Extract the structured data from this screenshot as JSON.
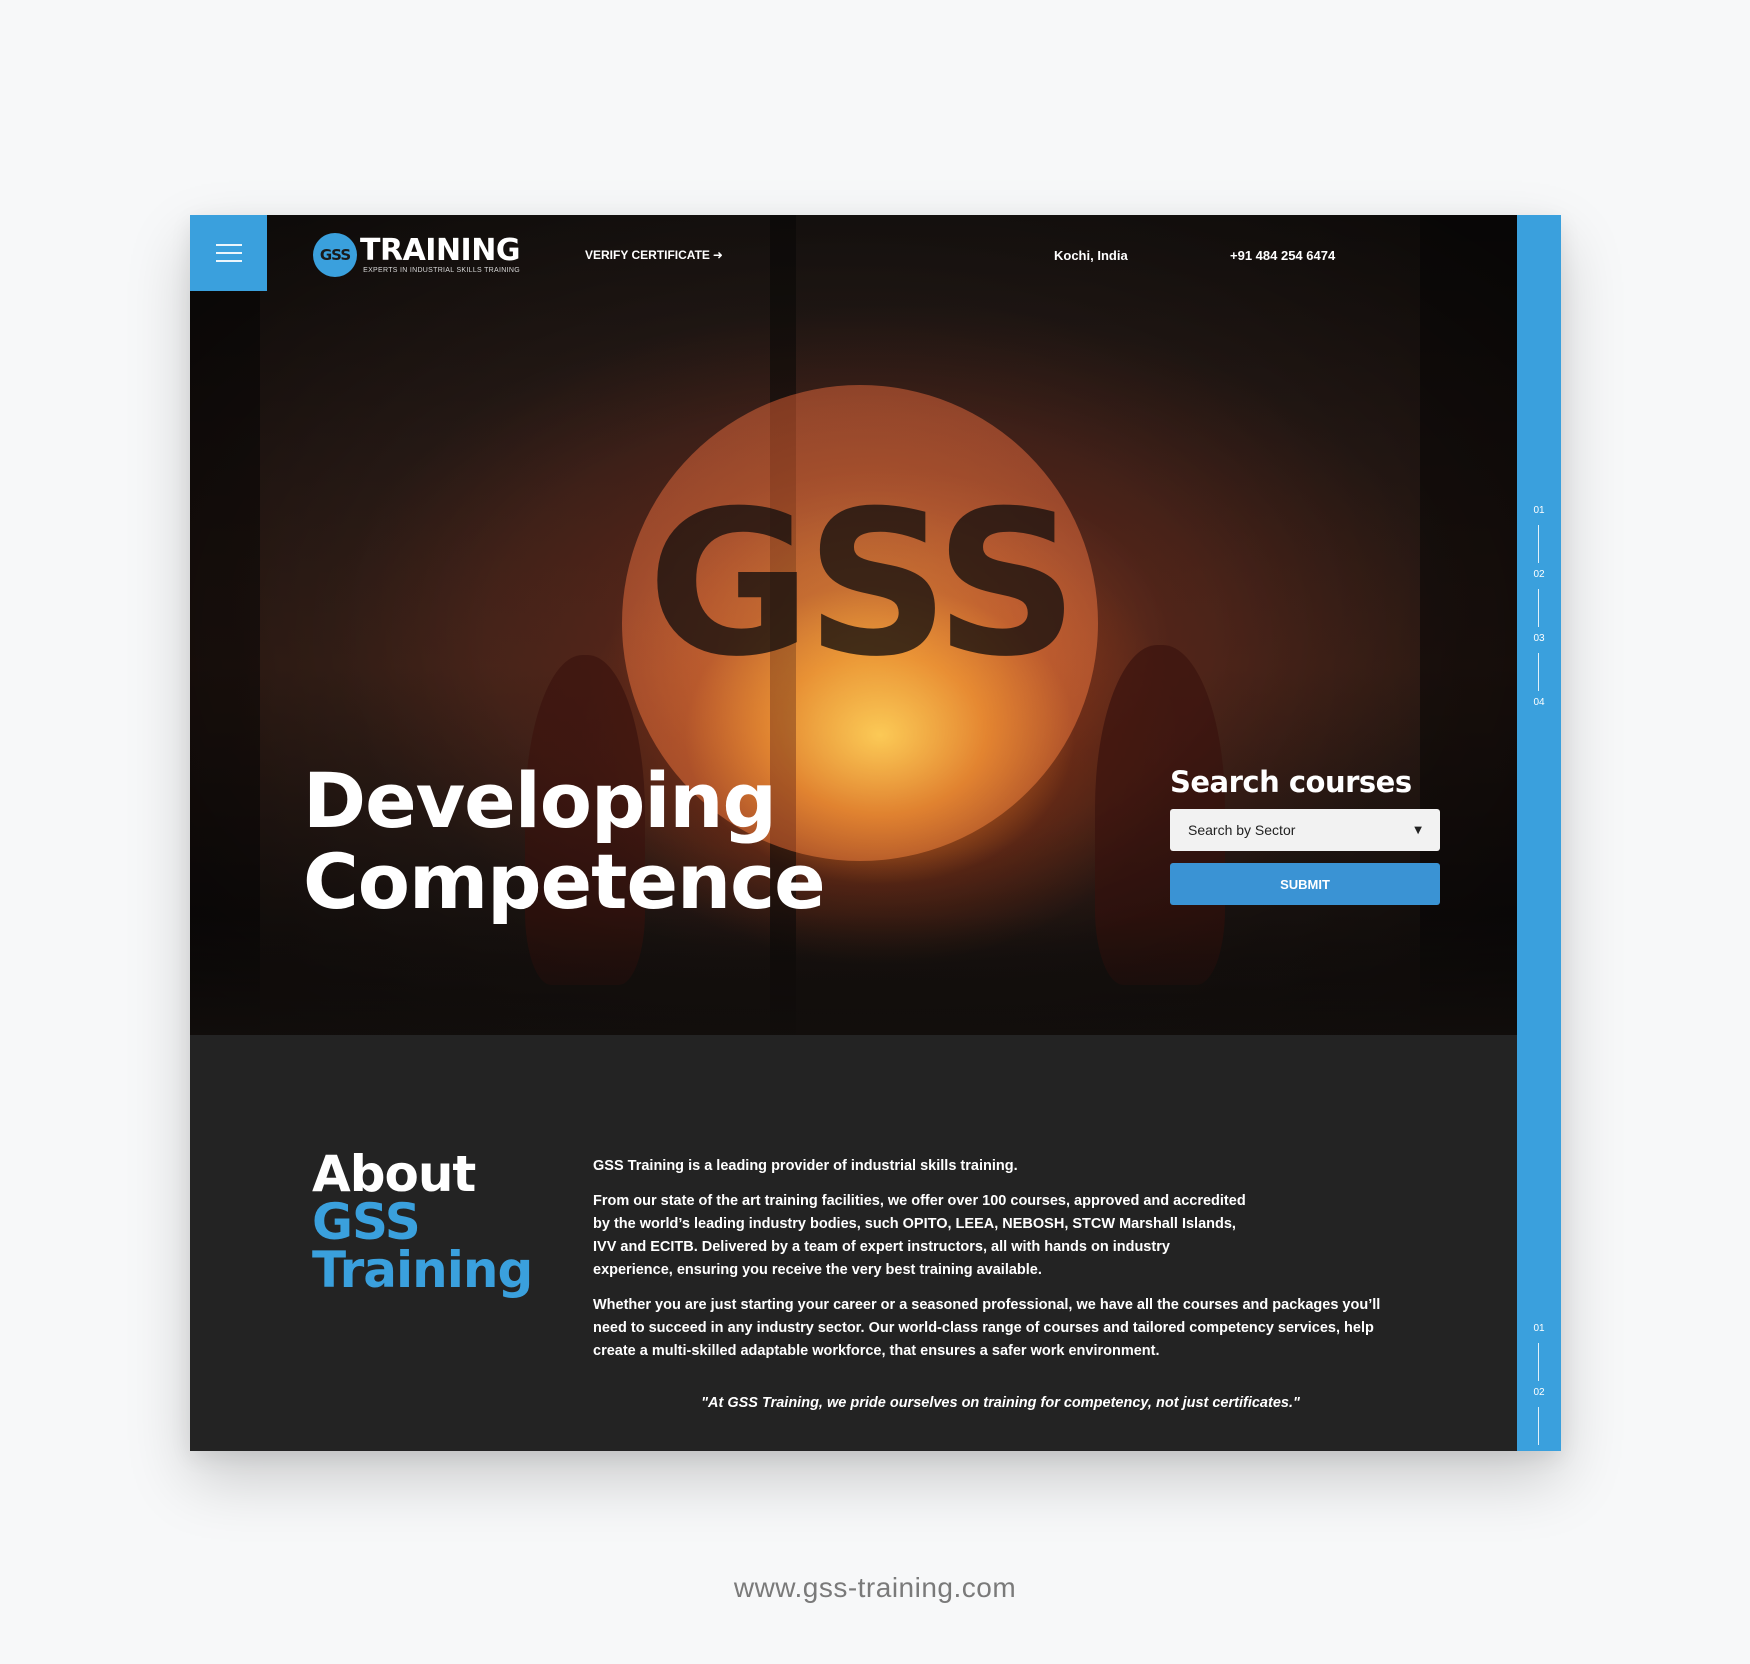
{
  "header": {
    "logo_badge": "GSS",
    "logo_word": "TRAINING",
    "logo_tagline": "EXPERTS IN INDUSTRIAL SKILLS TRAINING",
    "verify_label": "VERIFY CERTIFICATE",
    "verify_icon": "sign-in-arrow-icon",
    "location": "Kochi, India",
    "phone": "+91 484 254 6474",
    "menu_icon": "hamburger-icon"
  },
  "hero": {
    "background_letters": "GSS",
    "title_line1": "Developing",
    "title_line2": "Competence",
    "search": {
      "title": "Search courses",
      "select_value": "Search by Sector",
      "submit_label": "SUBMIT"
    },
    "rail_steps": [
      "01",
      "02",
      "03",
      "04"
    ]
  },
  "about": {
    "heading_line1": "About",
    "heading_line2": "GSS",
    "heading_line3": "Training",
    "paragraphs": [
      "GSS Training is a leading provider of industrial skills training.",
      "From our state of the art training facilities, we offer over 100 courses, approved and accredited by the world’s leading industry bodies, such OPITO, LEEA, NEBOSH, STCW Marshall Islands, IVV and ECITB. Delivered by a team of expert instructors, all with hands on industry experience, ensuring you receive the very best training available.",
      "Whether you are just starting your career or a seasoned professional, we have all the courses and packages you’ll need to succeed in any industry sector. Our world-class range of courses and tailored competency services, help create a multi-skilled adaptable workforce, that ensures a safer work environment."
    ],
    "quote": "\"At GSS Training, we pride ourselves on training for competency, not just certificates.\"",
    "rail_steps": [
      "01",
      "02"
    ]
  },
  "footer_url": "www.gss-training.com",
  "colors": {
    "accent": "#3aa0dd",
    "button": "#3a93d4",
    "dark_section": "#232323",
    "page_bg": "#f7f8f9"
  }
}
